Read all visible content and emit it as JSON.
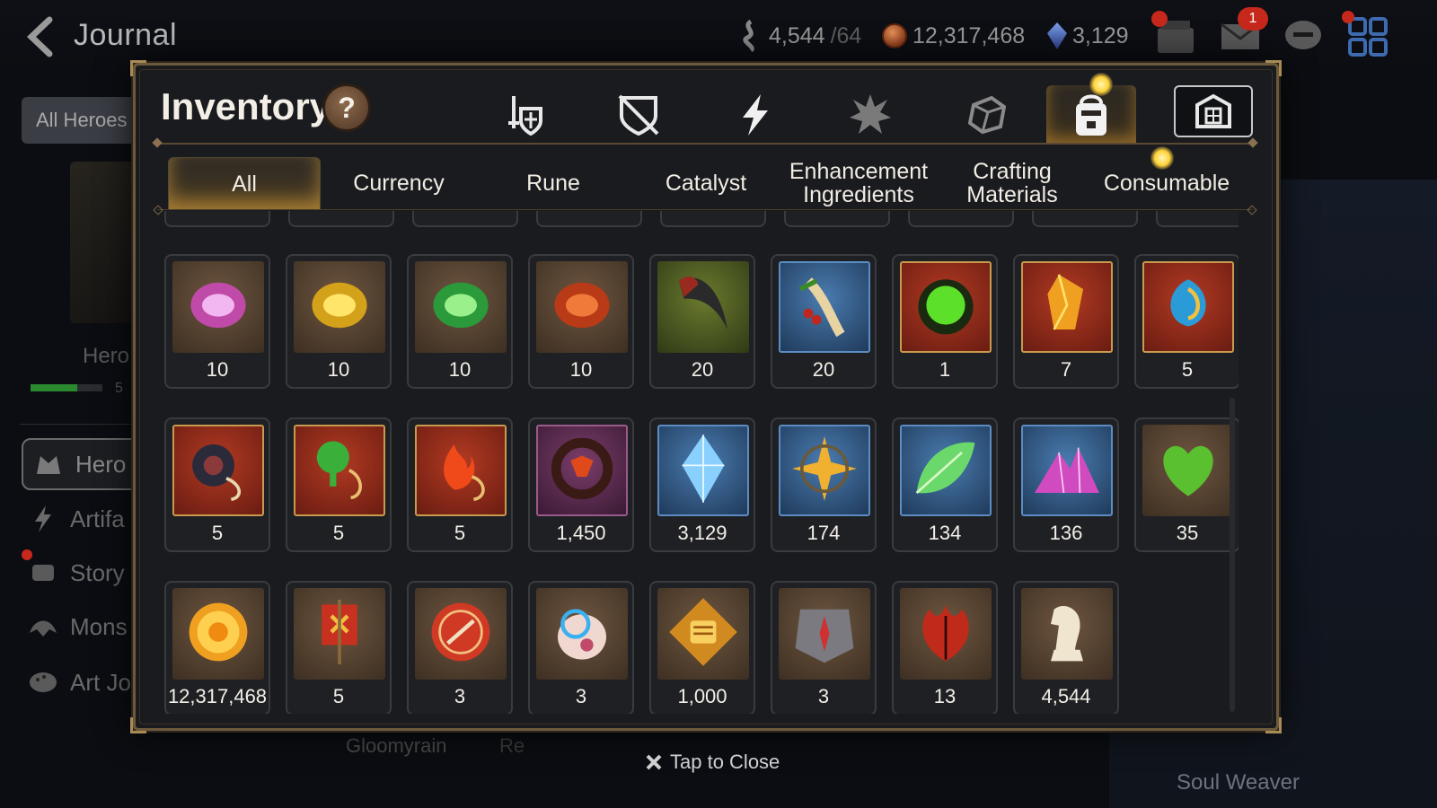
{
  "header": {
    "title": "Journal",
    "resources": [
      {
        "name": "stamina",
        "icon": "stamina-icon",
        "value": "4,544",
        "max": "/64"
      },
      {
        "name": "gold",
        "icon": "gold-coin-icon",
        "value": "12,317,468"
      },
      {
        "name": "crystal",
        "icon": "crystal-icon",
        "value": "3,129"
      }
    ],
    "mail_badge": "1"
  },
  "sidebar": {
    "all_heroes": "All Heroes",
    "hero_label": "Hero",
    "hero_progress": 0.65,
    "hero_count": "5",
    "items": [
      {
        "label": "Hero",
        "icon": "hero-icon"
      },
      {
        "label": "Artifa",
        "icon": "lightning-icon"
      },
      {
        "label": "Story",
        "icon": "scroll-icon"
      },
      {
        "label": "Mons",
        "icon": "monster-icon"
      },
      {
        "label": "Art Jo",
        "icon": "palette-icon"
      }
    ]
  },
  "background": {
    "gloomyrain": "Gloomyrain",
    "gloomy_partial": "Re",
    "soul_weaver": "Soul Weaver"
  },
  "inventory": {
    "title": "Inventory",
    "help": "?",
    "category_icons": [
      {
        "name": "equipment-icon",
        "active": false
      },
      {
        "name": "broken-shield-icon",
        "active": false
      },
      {
        "name": "artifact-lightning-icon",
        "active": false
      },
      {
        "name": "material-burst-icon",
        "active": false
      },
      {
        "name": "cube-icon",
        "active": false
      },
      {
        "name": "bag-icon",
        "active": true
      },
      {
        "name": "storage-icon",
        "active": false
      }
    ],
    "tabs": [
      {
        "label": "All",
        "active": true
      },
      {
        "label": "Currency",
        "active": false
      },
      {
        "label": "Rune",
        "active": false
      },
      {
        "label": "Catalyst",
        "active": false
      },
      {
        "label": "Enhancement Ingredients",
        "active": false
      },
      {
        "label": "Crafting Materials",
        "active": false
      },
      {
        "label": "Consumable",
        "active": false
      }
    ],
    "rows": [
      [
        {
          "icon": "purple-rune-icon",
          "bg": "brown",
          "qty": "10"
        },
        {
          "icon": "yellow-rune-icon",
          "bg": "brown",
          "qty": "10"
        },
        {
          "icon": "green-rune-icon",
          "bg": "brown",
          "qty": "10"
        },
        {
          "icon": "red-rune-icon",
          "bg": "brown",
          "qty": "10"
        },
        {
          "icon": "claw-icon",
          "bg": "green",
          "qty": "20"
        },
        {
          "icon": "root-herb-icon",
          "bg": "blue",
          "qty": "20"
        },
        {
          "icon": "green-orb-icon",
          "bg": "red",
          "qty": "1"
        },
        {
          "icon": "gold-crystal-icon",
          "bg": "red",
          "qty": "7"
        },
        {
          "icon": "blue-charm-icon",
          "bg": "red",
          "qty": "5"
        }
      ],
      [
        {
          "icon": "ring-charm-icon",
          "bg": "red",
          "qty": "5"
        },
        {
          "icon": "tree-charm-icon",
          "bg": "red",
          "qty": "5"
        },
        {
          "icon": "flame-charm-icon",
          "bg": "red",
          "qty": "5"
        },
        {
          "icon": "dark-ring-icon",
          "bg": "purple",
          "qty": "1,450"
        },
        {
          "icon": "skystone-icon",
          "bg": "blue",
          "qty": "3,129"
        },
        {
          "icon": "star-charm-icon",
          "bg": "blue",
          "qty": "174"
        },
        {
          "icon": "leaf-icon",
          "bg": "blue",
          "qty": "134"
        },
        {
          "icon": "crystal-pile-icon",
          "bg": "blue",
          "qty": "136"
        },
        {
          "icon": "heart-leaf-icon",
          "bg": "brown",
          "qty": "35"
        }
      ],
      [
        {
          "icon": "gold-coin-icon",
          "bg": "brown",
          "qty": "12,317,468"
        },
        {
          "icon": "banner-icon",
          "bg": "brown",
          "qty": "5"
        },
        {
          "icon": "red-badge-icon",
          "bg": "brown",
          "qty": "3"
        },
        {
          "icon": "pet-pod-icon",
          "bg": "brown",
          "qty": "3"
        },
        {
          "icon": "fist-medal-icon",
          "bg": "brown",
          "qty": "1,000"
        },
        {
          "icon": "compass-stone-icon",
          "bg": "brown",
          "qty": "3"
        },
        {
          "icon": "red-leaf-icon",
          "bg": "brown",
          "qty": "13"
        },
        {
          "icon": "knight-chess-icon",
          "bg": "brown",
          "qty": "4,544"
        }
      ]
    ]
  },
  "footer": {
    "close_label": "Tap to Close"
  }
}
